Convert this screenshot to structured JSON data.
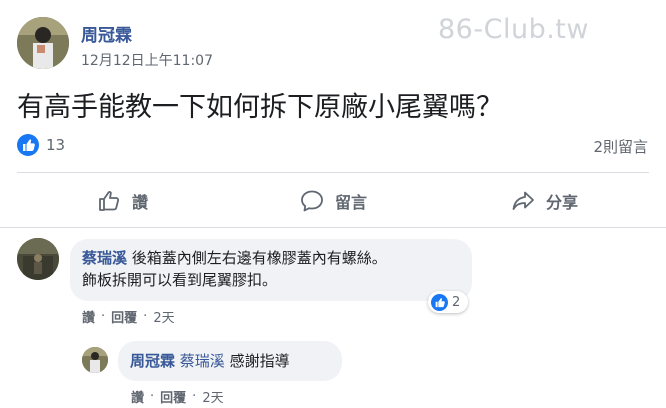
{
  "watermark": "86-Club.tw",
  "post": {
    "author": "周冠霖",
    "timestamp": "12月12日上午11:07",
    "text": "有高手能教一下如何拆下原廠小尾翼嗎？",
    "like_count": "13",
    "comment_count": "2則留言"
  },
  "actions": {
    "like": "讚",
    "comment": "留言",
    "share": "分享"
  },
  "comments": [
    {
      "author": "蔡瑞溪",
      "text_line1": "後箱蓋內側左右邊有橡膠蓋內有螺絲。",
      "text_line2": "飾板拆開可以看到尾翼膠扣。",
      "reaction_count": "2",
      "like_label": "讚",
      "reply_label": "回覆",
      "age": "2天"
    },
    {
      "author": "周冠霖",
      "mention": "蔡瑞溪",
      "text": "感謝指導",
      "like_label": "讚",
      "reply_label": "回覆",
      "age": "2天"
    }
  ],
  "colors": {
    "name_link": "#385898",
    "like_blue": "#1877f2",
    "secondary_text": "#606770",
    "bubble_bg": "#f0f2f5"
  }
}
